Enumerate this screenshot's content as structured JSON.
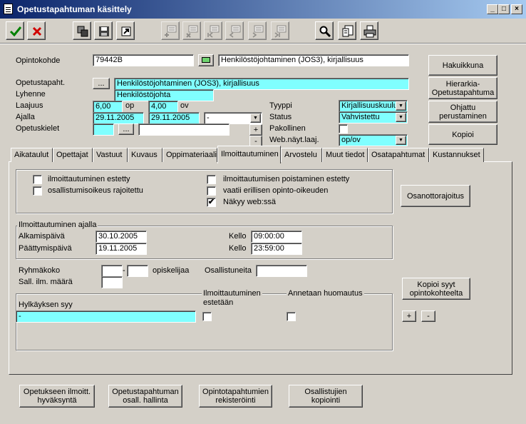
{
  "window": {
    "title": "Opetustapahtuman käsittely",
    "min": "_",
    "max": "□",
    "close": "×"
  },
  "toolbar": {
    "icons": [
      "checkmark-icon",
      "cancel-x-icon",
      "copy-icon",
      "save-icon",
      "export-icon",
      "insert-record-icon",
      "delete-record-icon",
      "first-record-icon",
      "previous-record-icon",
      "next-record-icon",
      "last-record-icon",
      "search-icon",
      "details-icon",
      "print-icon"
    ]
  },
  "header": {
    "opintokohde_label": "Opintokohde",
    "opintokohde_value": "79442B",
    "opintokohde_name": "Henkilöstöjohtaminen (JOS3), kirjallisuus",
    "opetustapaht_label": "Opetustapaht.",
    "opetustapaht_value": "Henkilöstöjohtaminen (JOS3), kirjallisuus",
    "lyhenne_label": "Lyhenne",
    "lyhenne_value": "Henkilöstöjohta",
    "laajuus_label": "Laajuus",
    "laajuus_op": "6,00",
    "op_unit": "op",
    "laajuus_ov": "4,00",
    "ov_unit": "ov",
    "ajalla_label": "Ajalla",
    "ajalla_start": "29.11.2005",
    "ajalla_end": "29.11.2005",
    "ajalla_select": "-",
    "opetuskielet_label": "Opetuskielet",
    "tyyppi_label": "Tyyppi",
    "tyyppi_value": "Kirjallisuuskuulu",
    "status_label": "Status",
    "status_value": "Vahvistettu",
    "pakollinen_label": "Pakollinen",
    "web_label": "Web.näyt.laaj.",
    "web_value": "op/ov",
    "ellipsis": "...",
    "plus": "+",
    "minus": "-"
  },
  "side_buttons": {
    "hakuikkuna": "Hakuikkuna",
    "hierarkia_1": "Hierarkia-",
    "hierarkia_2": "Opetustapahtuma",
    "ohjattu_1": "Ohjattu",
    "ohjattu_2": "perustaminen",
    "kopioi": "Kopioi"
  },
  "tabs": [
    "Aikataulut",
    "Opettajat",
    "Vastuut",
    "Kuvaus",
    "Oppimateriaali",
    "Ilmoittautuminen",
    "Arvostelu",
    "Muut tiedot",
    "Osatapahtumat",
    "Kustannukset"
  ],
  "panel": {
    "checks": {
      "estetty": "ilmoittautuminen estetty",
      "rajoitettu": "osallistumisoikeus rajoitettu",
      "poistaminen": "ilmoittautumisen poistaminen estetty",
      "erillinen": "vaatii erillisen opinto-oikeuden",
      "nakyy": "Näkyy web:ssä",
      "nakyy_mark": "✔"
    },
    "osanottorajoitus": "Osanottorajoitus",
    "ajalla_legend": "Ilmoittautuminen ajalla",
    "alkamis_label": "Alkamispäivä",
    "alkamis_value": "30.10.2005",
    "paattymis_label": "Päättymispäivä",
    "paattymis_value": "19.11.2005",
    "kello_label": "Kello",
    "kello_start": "09:00:00",
    "kello_end": "23:59:00",
    "ryhmakoko_label": "Ryhmäkoko",
    "dash": "-",
    "opiskelijaa": "opiskelijaa",
    "osallistuneita": "Osallistuneita",
    "sall_label": "Sall. ilm. määrä",
    "kopioi_syyt_1": "Kopioi syyt",
    "kopioi_syyt_2": "opintokohteelta",
    "hylkays_label": "Hylkäyksen syy",
    "hylkays_value": "-",
    "ilm_estetaan_1": "Ilmoittautuminen",
    "ilm_estetaan_2": "estetään",
    "huomautus": "Annetaan huomautus",
    "plus": "+",
    "minus": "-"
  },
  "bottom_buttons": [
    [
      "Opetukseen ilmoitt.",
      "hyväksyntä"
    ],
    [
      "Opetustapahtuman",
      "osall. hallinta"
    ],
    [
      "Opintotapahtumien",
      "rekisteröinti"
    ],
    [
      "Osallistujien",
      "kopiointi"
    ]
  ]
}
